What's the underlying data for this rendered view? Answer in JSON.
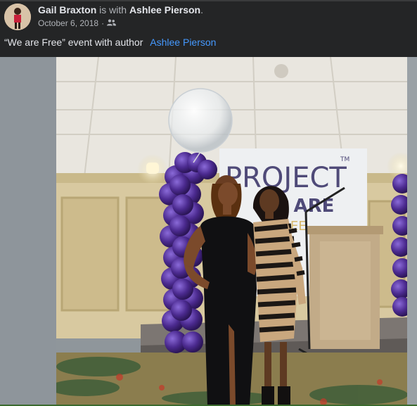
{
  "post": {
    "author": "Gail Braxton",
    "with_text": "is with",
    "tagged": "Ashlee Pierson",
    "period": ".",
    "date": "October 6, 2018",
    "separator": "·",
    "audience_icon": "friends-icon",
    "caption_text": "“We are Free” event with author",
    "caption_link": "Ashlee Pierson"
  },
  "photo": {
    "banner_line1": "PROJECT",
    "banner_line2": "WE ARE",
    "banner_line3": "FREE",
    "banner_tm": "TM"
  },
  "colors": {
    "background": "#242526",
    "link": "#4599ff",
    "balloon_purple": "#4b2a8f"
  }
}
